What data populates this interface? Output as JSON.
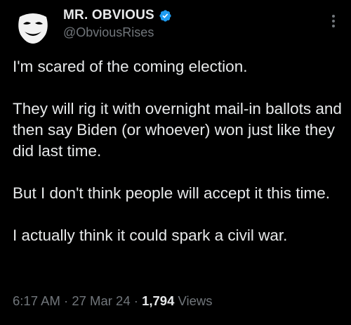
{
  "author": {
    "display_name": "MR. OBVIOUS",
    "handle": "@ObviousRises",
    "verified": true,
    "avatar_icon": "smiling-mask-avatar",
    "verified_color": "#1d9bf0"
  },
  "tweet": {
    "paragraphs": [
      "I'm scared of the coming election.",
      "They will rig it with overnight mail-in ballots and then say Biden (or whoever) won just like they did last time.",
      "But I don't think people will accept it this time.",
      "I actually think it could spark a civil war."
    ]
  },
  "meta": {
    "time": "6:17 AM",
    "separator": " · ",
    "date": "27 Mar 24",
    "views_count": "1,794",
    "views_label": "Views"
  },
  "colors": {
    "background": "#000000",
    "primary_text": "#e7e9ea",
    "secondary_text": "#71767b"
  }
}
